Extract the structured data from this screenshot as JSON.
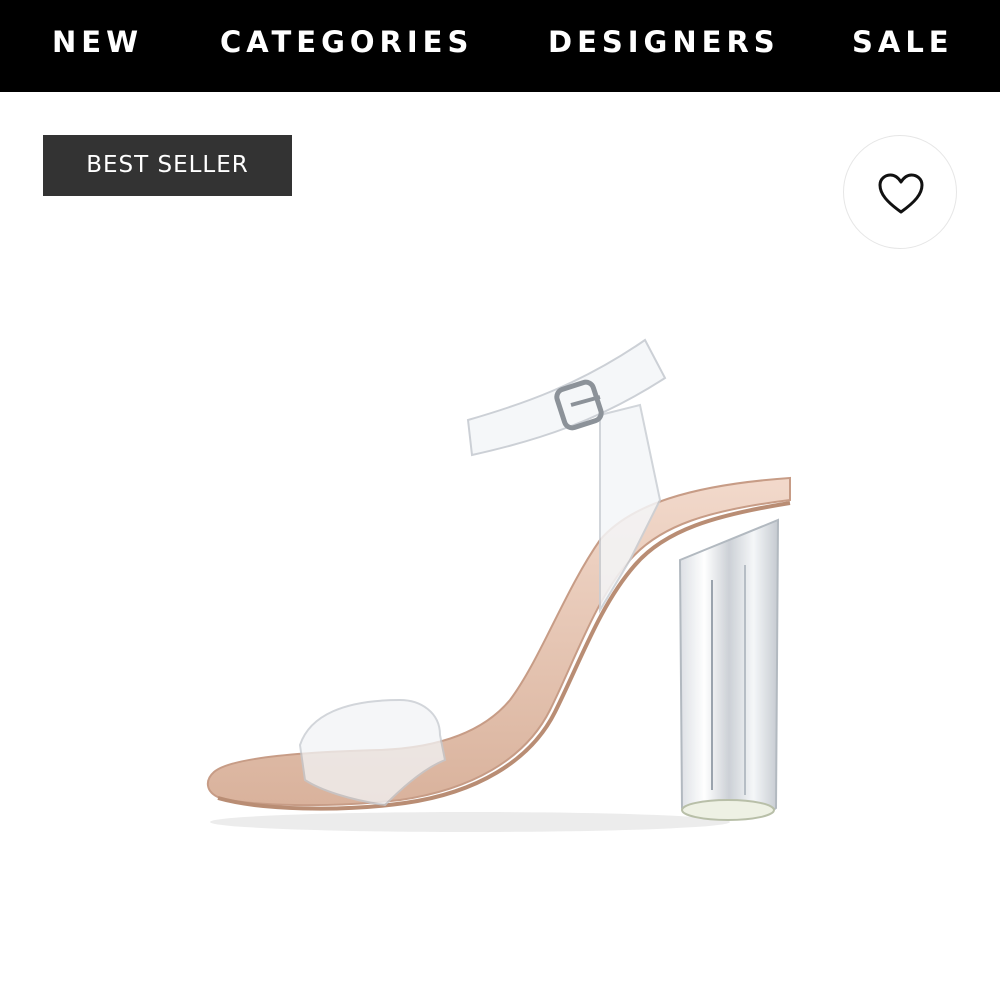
{
  "nav": {
    "items": [
      {
        "label": "NEW"
      },
      {
        "label": "CATEGORIES"
      },
      {
        "label": "DESIGNERS"
      },
      {
        "label": "SALE"
      }
    ]
  },
  "product": {
    "badge": "BEST SELLER",
    "wishlist_icon": "heart-outline-icon",
    "image": "clear-strap-block-heel-sandal"
  },
  "colors": {
    "nav_bg": "#000000",
    "nav_text": "#ffffff",
    "badge_bg": "#333333",
    "badge_text": "#ffffff",
    "sole": "#e8c7b4"
  }
}
